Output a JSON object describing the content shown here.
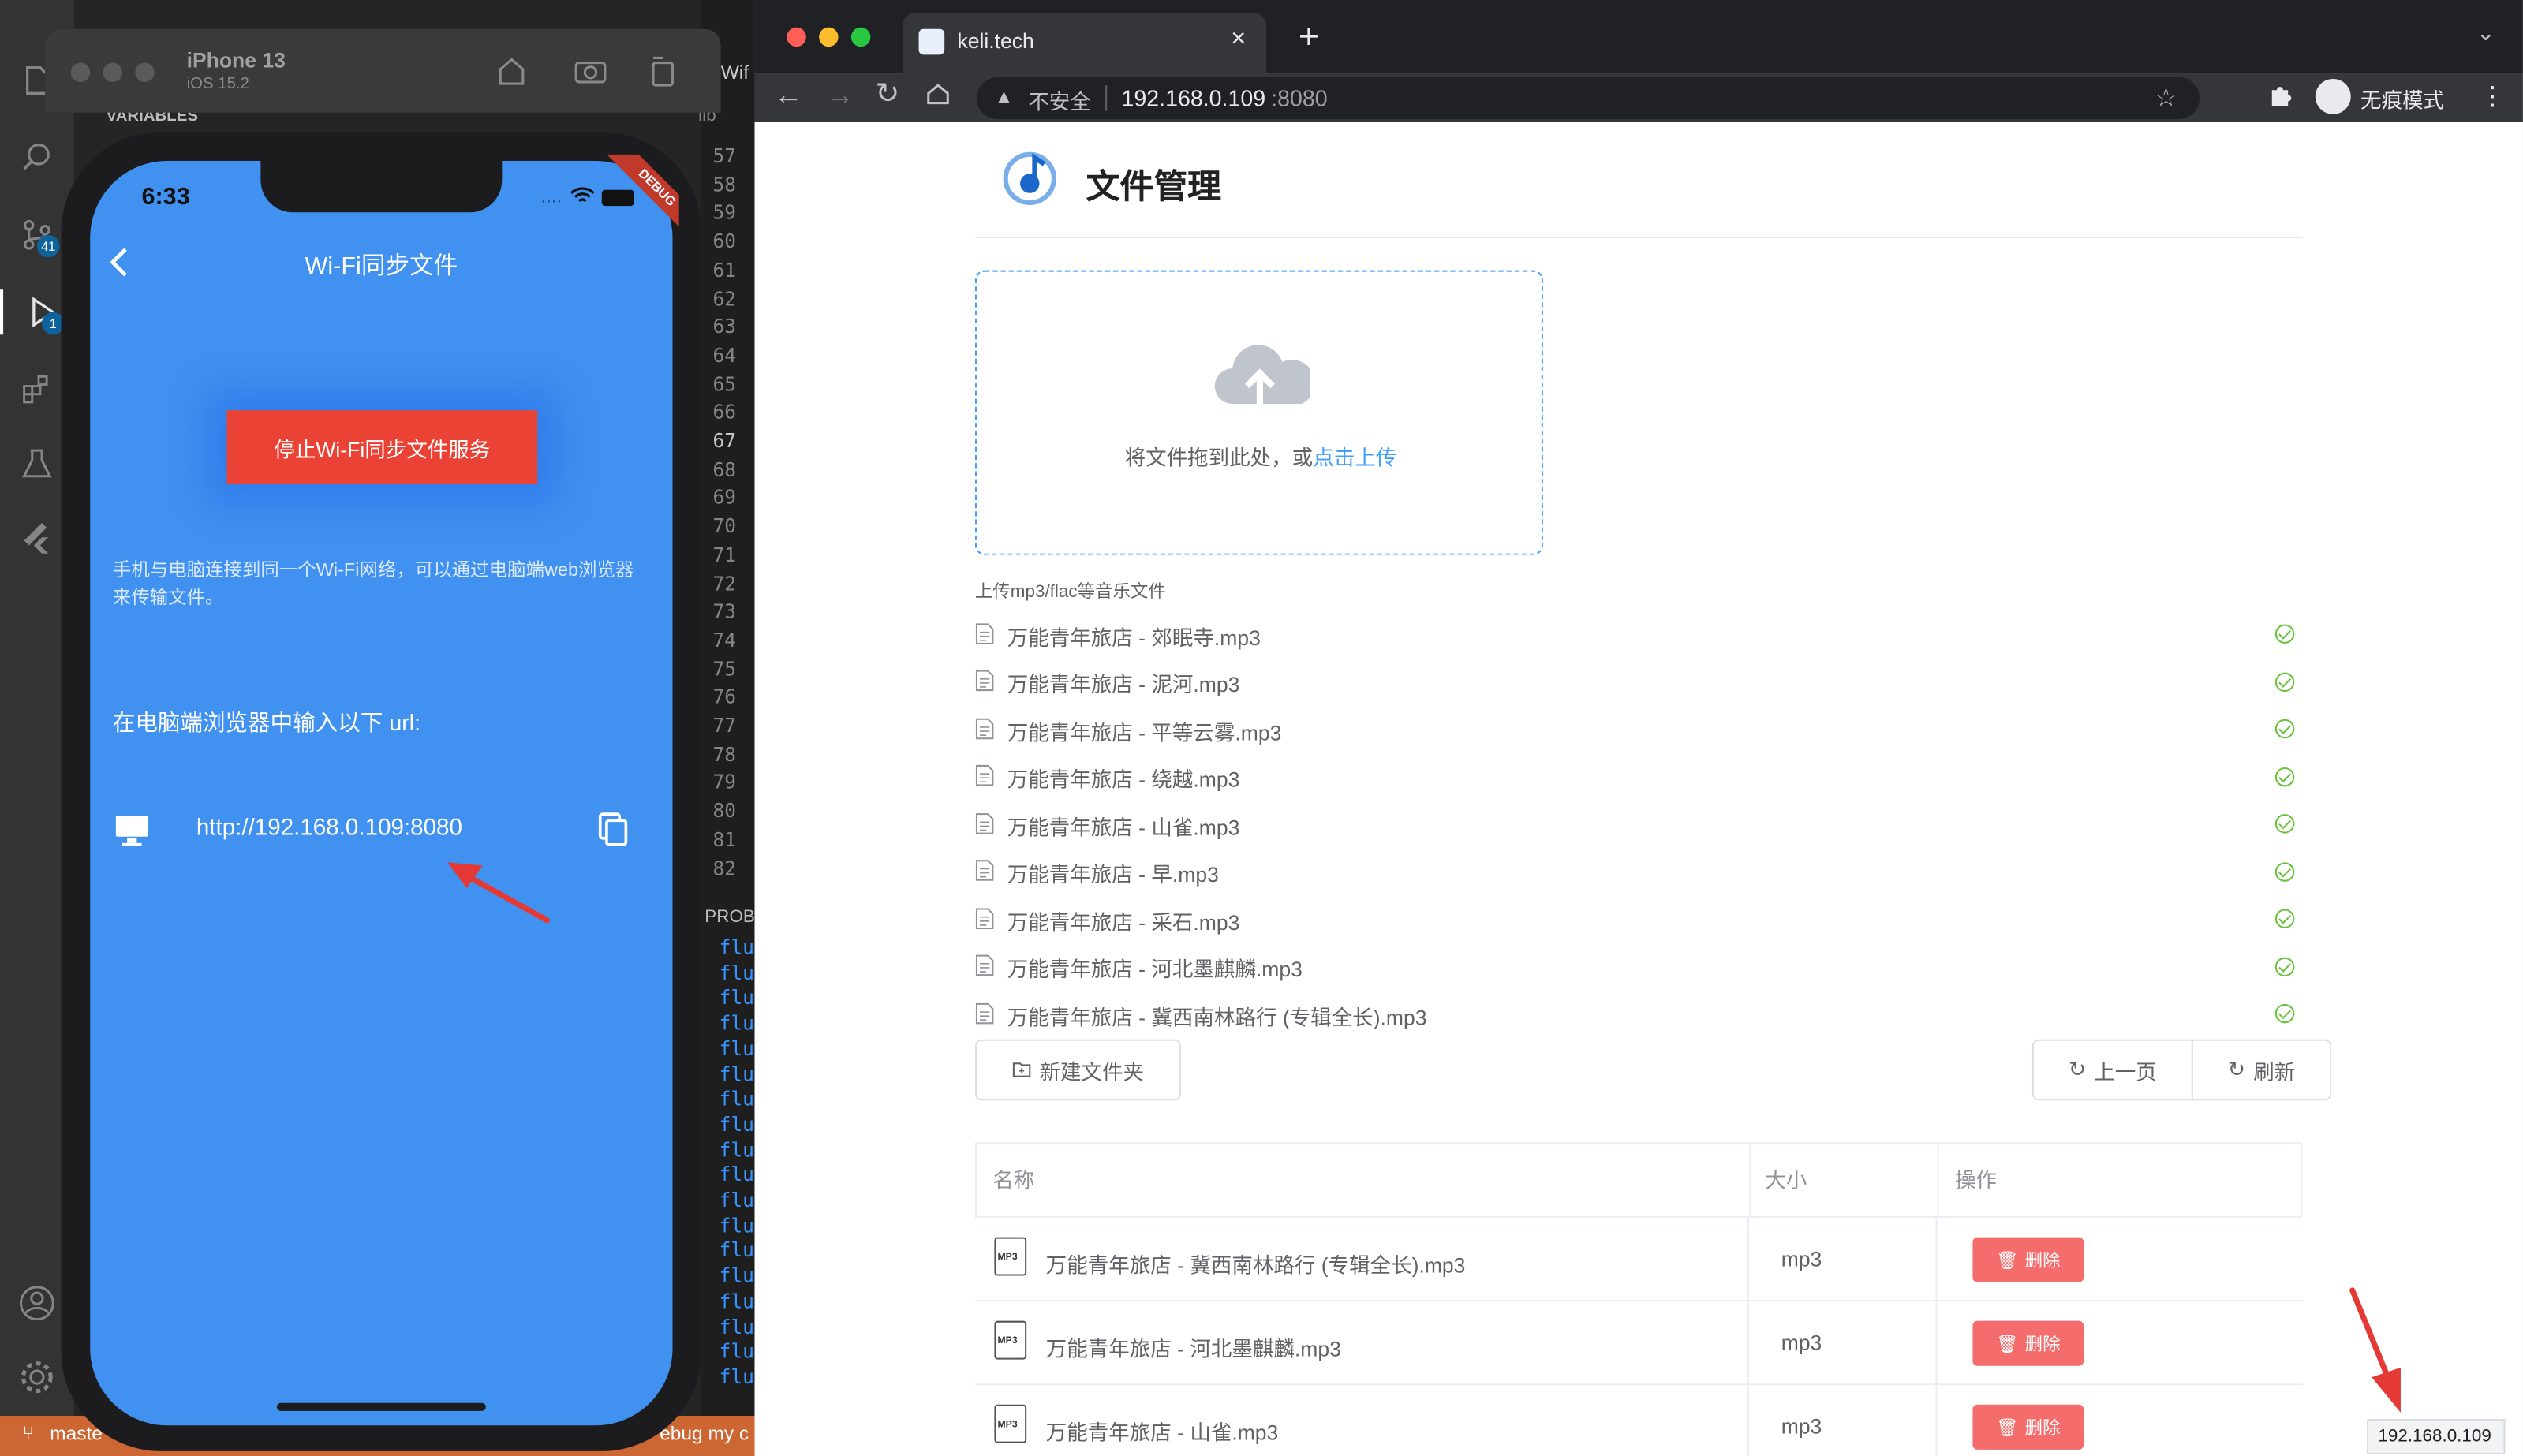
{
  "vscode": {
    "variables_label": "VARIABLES",
    "breadcrumb": "lib",
    "tab_partial": "Wif",
    "line_numbers": [
      "57",
      "58",
      "59",
      "60",
      "61",
      "62",
      "63",
      "64",
      "65",
      "66",
      "67",
      "68",
      "69",
      "70",
      "71",
      "72",
      "73",
      "74",
      "75",
      "76",
      "77",
      "78",
      "79",
      "80",
      "81",
      "82"
    ],
    "panel_label": "PROB",
    "debug_lines": [
      "flu",
      "flu",
      "flu",
      "flu",
      "flu",
      "flu",
      "flu",
      "flu",
      "flu",
      "flu",
      "flu",
      "flu",
      "flu",
      "flu",
      "flu",
      "flu",
      "flu",
      "flu"
    ],
    "badge_scm": "41",
    "badge_debug": "1",
    "status_branch": "maste",
    "status_debug": "ebug my c"
  },
  "simulator": {
    "device_name": "iPhone 13",
    "os_version": "iOS 15.2",
    "time": "6:33",
    "debug_ribbon": "DEBUG",
    "app_title": "Wi-Fi同步文件",
    "stop_button": "停止Wi-Fi同步文件服务",
    "hint": "手机与电脑连接到同一个Wi-Fi网络，可以通过电脑端web浏览器来传输文件。",
    "url_prompt": "在电脑端浏览器中输入以下 url:",
    "url": "http://192.168.0.109:8080"
  },
  "browser": {
    "tab_title": "keli.tech",
    "insecure_label": "不安全",
    "url_host": "192.168.0.109",
    "url_port": ":8080",
    "incognito_label": "无痕模式",
    "status_url": "192.168.0.109"
  },
  "page": {
    "title": "文件管理",
    "upload_text": "将文件拖到此处，或",
    "upload_link": "点击上传",
    "upload_tip": "上传mp3/flac等音乐文件",
    "uploaded_files": [
      "万能青年旅店 - 郊眠寺.mp3",
      "万能青年旅店 - 泥河.mp3",
      "万能青年旅店 - 平等云雾.mp3",
      "万能青年旅店 - 绕越.mp3",
      "万能青年旅店 - 山雀.mp3",
      "万能青年旅店 - 早.mp3",
      "万能青年旅店 - 采石.mp3",
      "万能青年旅店 - 河北墨麒麟.mp3",
      "万能青年旅店 - 冀西南林路行 (专辑全长).mp3"
    ],
    "new_folder_button": "新建文件夹",
    "prev_button": "上一页",
    "refresh_button": "刷新",
    "table": {
      "headers": [
        "名称",
        "大小",
        "操作"
      ],
      "rows": [
        {
          "name": "万能青年旅店 - 冀西南林路行 (专辑全长).mp3",
          "size": "mp3",
          "action": "删除"
        },
        {
          "name": "万能青年旅店 - 河北墨麒麟.mp3",
          "size": "mp3",
          "action": "删除"
        },
        {
          "name": "万能青年旅店 - 山雀.mp3",
          "size": "mp3",
          "action": "删除"
        }
      ]
    }
  },
  "colors": {
    "phone_screen": "#4192f0",
    "stop_button": "#ea4335",
    "delete_button": "#f56c6c",
    "success": "#67c23a",
    "link": "#409eff",
    "annotation_arrow": "#e53935"
  }
}
